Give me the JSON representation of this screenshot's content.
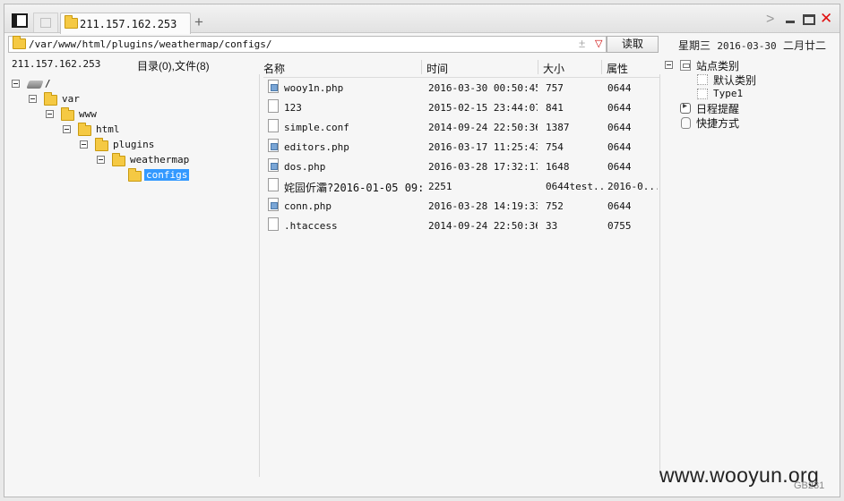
{
  "tab": {
    "label": "211.157.162.253"
  },
  "address": {
    "path": "/var/www/html/plugins/weathermap/configs/",
    "read_label": "读取"
  },
  "calendar": {
    "weekday": "星期三",
    "date": "2016-03-30",
    "lunar": "二月廿二"
  },
  "left": {
    "host": "211.157.162.253",
    "count": "目录(0),文件(8)",
    "tree": [
      "/",
      "var",
      "www",
      "html",
      "plugins",
      "weathermap",
      "configs"
    ]
  },
  "columns": {
    "name": "名称",
    "time": "时间",
    "size": "大小",
    "attr": "属性"
  },
  "files": [
    {
      "name": "wooy1n.php",
      "time": "2016-03-30 00:50:45",
      "size": "757",
      "attr": "0644"
    },
    {
      "name": "123",
      "time": "2015-02-15 23:44:07",
      "size": "841",
      "attr": "0644"
    },
    {
      "name": "simple.conf",
      "time": "2014-09-24 22:50:36",
      "size": "1387",
      "attr": "0644"
    },
    {
      "name": "editors.php",
      "time": "2016-03-17 11:25:43",
      "size": "754",
      "attr": "0644"
    },
    {
      "name": "dos.php",
      "time": "2016-03-28 17:32:17",
      "size": "1648",
      "attr": "0644"
    },
    {
      "name": "姹囩伒灞?2016-01-05 09:...",
      "time": "2251",
      "size": "0644test...",
      "attr": "2016-0..."
    },
    {
      "name": "conn.php",
      "time": "2016-03-28 14:19:33",
      "size": "752",
      "attr": "0644"
    },
    {
      "name": ".htaccess",
      "time": "2014-09-24 22:50:36",
      "size": "33",
      "attr": "0755"
    }
  ],
  "right": {
    "category": "站点类别",
    "default_category": "默认类别",
    "type1": "Type1",
    "schedule": "日程提醒",
    "shortcut": "快捷方式"
  },
  "watermark": "www.wooyun.org",
  "corner_tag": "GB231"
}
